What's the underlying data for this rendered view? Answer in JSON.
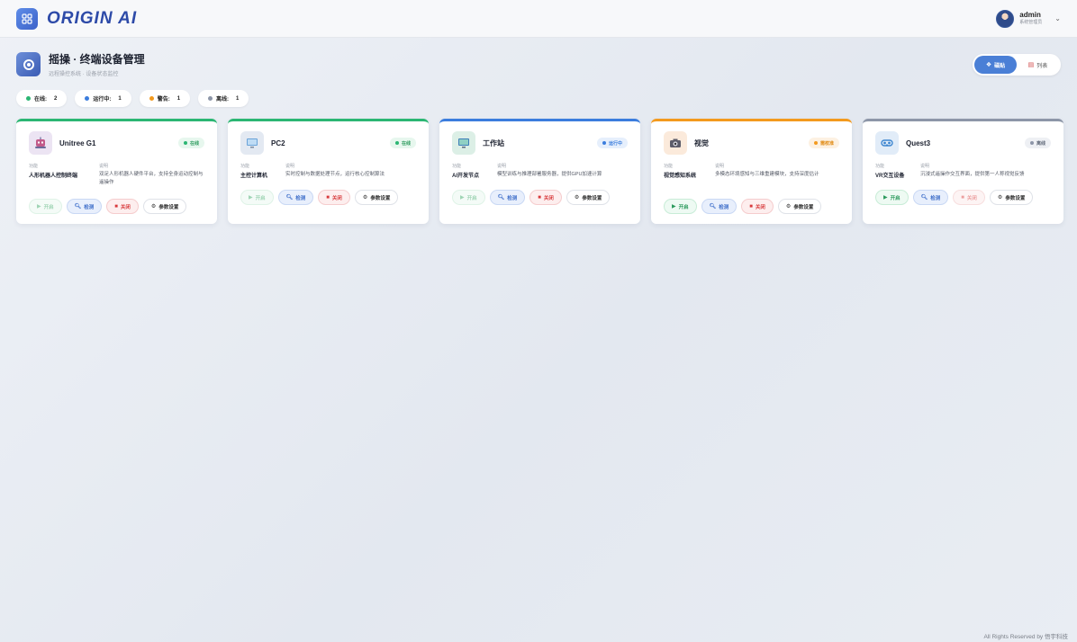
{
  "app": {
    "title": "ORIGIN AI"
  },
  "user": {
    "name": "admin",
    "role": "系统管理员"
  },
  "page": {
    "title": "摇操 · 终端设备管理",
    "subtitle": "远程操控系统 · 设备状态监控"
  },
  "view_toggle": {
    "card_label": "磁贴",
    "list_label": "列表",
    "active": "card"
  },
  "stats": [
    {
      "label": "在线:",
      "count": "2",
      "color": "#2bb673"
    },
    {
      "label": "运行中:",
      "count": "1",
      "color": "#3b7ddd"
    },
    {
      "label": "警告:",
      "count": "1",
      "color": "#f39a1e"
    },
    {
      "label": "离线:",
      "count": "1",
      "color": "#8d96a8"
    }
  ],
  "labels": {
    "function": "功能",
    "description": "说明"
  },
  "devices": [
    {
      "name": "Unitree G1",
      "icon": "robot-icon",
      "status": "在线",
      "status_color": "#2bb673",
      "function": "人形机器人控制终端",
      "description": "双足人形机器人硬件平台，支持全身运动控制与遥操作",
      "actions": {
        "start": "开启",
        "check": "检测",
        "close": "关闭",
        "params": "参数设置"
      }
    },
    {
      "name": "PC2",
      "icon": "computer-icon",
      "status": "在线",
      "status_color": "#2bb673",
      "function": "主控计算机",
      "description": "实时控制与数据处理节点，运行核心控制算法",
      "actions": {
        "start": "开启",
        "check": "检测",
        "close": "关闭",
        "params": "参数设置"
      }
    },
    {
      "name": "工作站",
      "icon": "monitor-icon",
      "status": "运行中",
      "status_color": "#3b7ddd",
      "function": "AI开发节点",
      "description": "模型训练与推理部署服务器，提供GPU加速计算",
      "actions": {
        "start": "开启",
        "check": "检测",
        "close": "关闭",
        "params": "参数设置"
      }
    },
    {
      "name": "视觉",
      "icon": "camera-icon",
      "status": "需校准",
      "status_color": "#f39a1e",
      "function": "视觉感知系统",
      "description": "多模态环境感知与三维重建模块，支持深度估计",
      "actions": {
        "start": "开启",
        "check": "检测",
        "close": "关闭",
        "params": "参数设置"
      }
    },
    {
      "name": "Quest3",
      "icon": "vr-headset-icon",
      "status": "离线",
      "status_color": "#8d96a8",
      "function": "VR交互设备",
      "description": "沉浸式遥操作交互界面，提供第一人称视觉反馈",
      "actions": {
        "start": "开启",
        "check": "检测",
        "close": "关闭",
        "params": "参数设置"
      }
    }
  ],
  "footer": {
    "text": "All Rights Reserved by 悟宇科技"
  }
}
